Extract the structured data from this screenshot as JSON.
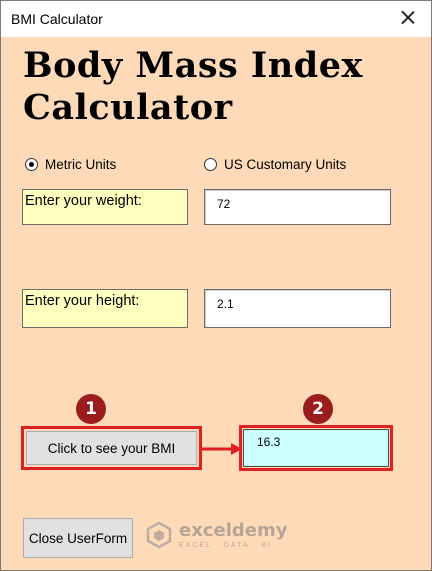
{
  "window": {
    "title": "BMI Calculator"
  },
  "heading": {
    "line1": "Body Mass Index",
    "line2": "Calculator"
  },
  "units": {
    "metric": {
      "label": "Metric Units",
      "selected": true
    },
    "us": {
      "label": "US Customary Units",
      "selected": false
    }
  },
  "weight": {
    "label": "Enter your weight:",
    "value": "72"
  },
  "height": {
    "label": "Enter your height:",
    "value": "2.1"
  },
  "calc_button": {
    "label": "Click to see your BMI"
  },
  "result": {
    "value": "16.3"
  },
  "close_button": {
    "label": "Close UserForm"
  },
  "badges": {
    "one": "1",
    "two": "2"
  },
  "watermark": {
    "name": "exceldemy",
    "tagline": "EXCEL · DATA · BI"
  },
  "colors": {
    "form_bg": "#ffdab9",
    "label_bg": "#ffffc0",
    "result_bg": "#ccffff",
    "highlight": "#e02020",
    "badge": "#9b1c1c"
  }
}
